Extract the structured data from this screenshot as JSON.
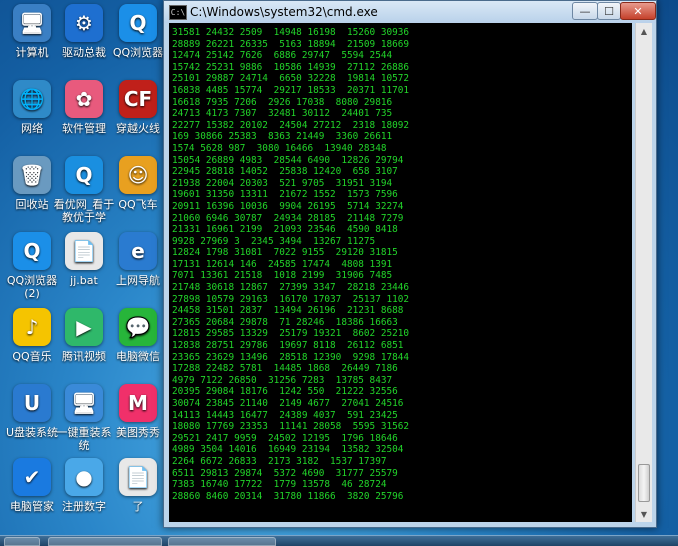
{
  "desktop": {
    "icons": [
      {
        "label": "计算机",
        "icon": "computer-icon",
        "color": "#3a7fc4",
        "glyph": "🖥"
      },
      {
        "label": "驱动总裁",
        "icon": "driver-icon",
        "color": "#1e6fd0",
        "glyph": "⚙"
      },
      {
        "label": "QQ浏览器",
        "icon": "qq-browser-icon",
        "color": "#1b8fe8",
        "glyph": "Q"
      },
      {
        "label": "网络",
        "icon": "network-icon",
        "color": "#2f8ac8",
        "glyph": "🌐"
      },
      {
        "label": "软件管理",
        "icon": "software-manager-icon",
        "color": "#e85a7d",
        "glyph": "✿"
      },
      {
        "label": "穿越火线",
        "icon": "crossfire-icon",
        "color": "#c0201a",
        "glyph": "CF"
      },
      {
        "label": "回收站",
        "icon": "recycle-bin-icon",
        "color": "#6a9ac0",
        "glyph": "🗑"
      },
      {
        "label": "看优网_看于教优于学",
        "icon": "browser-icon",
        "color": "#1a8fe0",
        "glyph": "Q"
      },
      {
        "label": "QQ飞车",
        "icon": "qq-speed-icon",
        "color": "#e8a020",
        "glyph": "☺"
      },
      {
        "label": "QQ浏览器(2)",
        "icon": "qq-browser-icon",
        "color": "#1b8fe8",
        "glyph": "Q"
      },
      {
        "label": "jj.bat",
        "icon": "batch-file-icon",
        "color": "#e8e8e8",
        "glyph": "📄"
      },
      {
        "label": "上网导航",
        "icon": "ie-icon",
        "color": "#2a7bd0",
        "glyph": "e"
      },
      {
        "label": "QQ音乐",
        "icon": "qq-music-icon",
        "color": "#f5c400",
        "glyph": "♪"
      },
      {
        "label": "腾讯视频",
        "icon": "tencent-video-icon",
        "color": "#2fb86a",
        "glyph": "▶"
      },
      {
        "label": "电脑微信",
        "icon": "wechat-icon",
        "color": "#27b53a",
        "glyph": "💬"
      },
      {
        "label": "U盘装系统",
        "icon": "usb-installer-icon",
        "color": "#2a7ad0",
        "glyph": "U"
      },
      {
        "label": "一键重装系统",
        "icon": "reinstall-icon",
        "color": "#3a8ad8",
        "glyph": "🖥"
      },
      {
        "label": "美图秀秀",
        "icon": "meitu-icon",
        "color": "#f0306a",
        "glyph": "M"
      },
      {
        "label": "电脑管家",
        "icon": "pc-manager-icon",
        "color": "#1a7ae0",
        "glyph": "✔"
      },
      {
        "label": "注册数字",
        "icon": "bird-icon",
        "color": "#4aa8e8",
        "glyph": "●"
      },
      {
        "label": "了",
        "icon": "text-file-icon",
        "color": "#e8e8e8",
        "glyph": "📄"
      }
    ]
  },
  "window": {
    "title": "C:\\Windows\\system32\\cmd.exe",
    "title_icon_text": "C:\\",
    "min_glyph": "—",
    "max_glyph": "☐",
    "close_glyph": "✕",
    "text_color": "#22d42a",
    "lines": [
      "31581 24432 2509  14948 16198  15260 30936",
      "28889 26221 26335  5163 18894  21509 18669",
      "12474 25142 7626  6886 29747  5594 2544",
      "15742 25231 9886  10586 14939  27112 26886",
      "25101 29887 24714  6650 32228  19814 10572",
      "16838 4485 15774  29217 18533  20371 11701",
      "16618 7935 7206  2926 17038  8080 29816",
      "24713 4173 7307  32481 30112  24401 735",
      "22277 15382 20102  24504 27212  2318 18092",
      "169 30866 25383  8363 21449  3360 26611",
      "1574 5628 987  3080 16466  13940 28348",
      "15054 26889 4983  28544 6490  12826 29794",
      "22945 28818 14052  25838 12420  658 3107",
      "21938 22004 20303  521 9705  31951 3194",
      "19601 31350 13311  21672 1552  1573 7596",
      "20911 16396 10036  9904 26195  5714 32274",
      "21060 6946 30787  24934 28185  21148 7279",
      "21331 16961 2199  21093 23546  4590 8418",
      "9928 27969 3  2345 3494  13267 11275",
      "12824 1798 31081  7022 9155  29120 31815",
      "17131 12614 146  24585 17474  4808 1391",
      "7071 13361 21518  1018 2199  31906 7485",
      "21748 30618 12867  27399 3347  28218 23446",
      "27898 10579 29163  16170 17037  25137 1102",
      "24458 31501 2837  13494 26196  21231 8688",
      "27365 20684 29878  71 28246  18386 16663",
      "12815 29585 13329  25179 19321  8602 25210",
      "12838 28751 29786  19697 8118  26112 6851",
      "23365 23629 13496  28518 12390  9298 17844",
      "17288 22482 5781  14485 1868  26449 7186",
      "4979 7122 26850  31256 7283  13785 8437",
      "20395 29084 18176  1242 550  21222 32556",
      "30074 23845 21140  2149 4677  27041 24516",
      "14113 14443 16477  24389 4037  591 23425",
      "18080 17769 23353  11141 28058  5595 31562",
      "29521 2417 9959  24502 12195  1796 18646",
      "4989 3504 14016  16949 23194  13582 32504",
      "2264 6672 26833  2173 3182  1537 17397",
      "6511 29813 29874  5372 4690  31777 25579",
      "7383 16740 17722  1779 13578  46 28724",
      "28860 8460 20314  31780 11866  3820 25796"
    ]
  },
  "scrollbar": {
    "up_glyph": "▲",
    "down_glyph": "▼"
  }
}
